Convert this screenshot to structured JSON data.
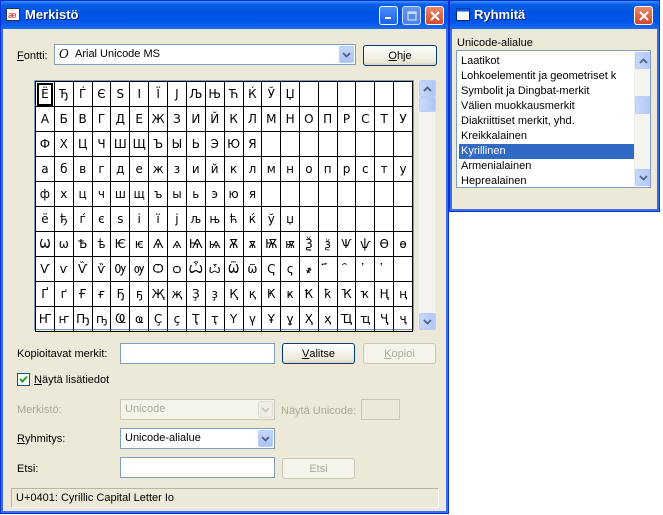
{
  "colors": {
    "titlebar": "#0054e3",
    "selection": "#316ac5",
    "face": "#ece9d8"
  },
  "main_window": {
    "title": "Merkistö",
    "icon": "charmap-icon",
    "font_label_prefix": "F",
    "font_label_rest": "ontti:",
    "font_value": "Arial Unicode MS",
    "font_type_glyph": "O",
    "help_prefix": "O",
    "help_rest": "hje",
    "grid_rows": [
      [
        "Ё",
        "Ђ",
        "Ѓ",
        "Є",
        "Ѕ",
        "І",
        "Ї",
        "Ј",
        "Љ",
        "Њ",
        "Ћ",
        "Ќ",
        "Ў",
        "Џ",
        "",
        "",
        "",
        "",
        "",
        ""
      ],
      [
        "А",
        "Б",
        "В",
        "Г",
        "Д",
        "Е",
        "Ж",
        "З",
        "И",
        "Й",
        "К",
        "Л",
        "М",
        "Н",
        "О",
        "П",
        "Р",
        "С",
        "Т",
        "У"
      ],
      [
        "Ф",
        "Х",
        "Ц",
        "Ч",
        "Ш",
        "Щ",
        "Ъ",
        "Ы",
        "Ь",
        "Э",
        "Ю",
        "Я",
        "",
        "",
        "",
        "",
        "",
        "",
        "",
        ""
      ],
      [
        "а",
        "б",
        "в",
        "г",
        "д",
        "е",
        "ж",
        "з",
        "и",
        "й",
        "к",
        "л",
        "м",
        "н",
        "о",
        "п",
        "р",
        "с",
        "т",
        "у"
      ],
      [
        "ф",
        "х",
        "ц",
        "ч",
        "ш",
        "щ",
        "ъ",
        "ы",
        "ь",
        "э",
        "ю",
        "я",
        "",
        "",
        "",
        "",
        "",
        "",
        "",
        ""
      ],
      [
        "ё",
        "ђ",
        "ѓ",
        "є",
        "ѕ",
        "і",
        "ї",
        "ј",
        "љ",
        "њ",
        "ћ",
        "ќ",
        "ў",
        "џ",
        "",
        "",
        "",
        "",
        "",
        ""
      ],
      [
        "Ѡ",
        "ѡ",
        "Ѣ",
        "ѣ",
        "Ѥ",
        "ѥ",
        "Ѧ",
        "ѧ",
        "Ѩ",
        "ѩ",
        "Ѫ",
        "ѫ",
        "Ѭ",
        "ѭ",
        "Ѯ",
        "ѯ",
        "Ѱ",
        "ѱ",
        "Ѳ",
        "ѳ"
      ],
      [
        "Ѵ",
        "ѵ",
        "Ѷ",
        "ѷ",
        "Ѹ",
        "ѹ",
        "Ѻ",
        "ѻ",
        "Ѽ",
        "ѽ",
        "Ѿ",
        "ѿ",
        "Ҁ",
        "ҁ",
        "҂",
        "҃",
        "҄",
        "҅",
        "҆",
        ""
      ],
      [
        "Ґ",
        "ґ",
        "Ғ",
        "ғ",
        "Ҕ",
        "ҕ",
        "Җ",
        "җ",
        "Ҙ",
        "ҙ",
        "Қ",
        "қ",
        "Ҝ",
        "ҝ",
        "Ҟ",
        "ҟ",
        "Ҡ",
        "ҡ",
        "Ң",
        "ң"
      ],
      [
        "Ҥ",
        "ҥ",
        "Ҧ",
        "ҧ",
        "Ҩ",
        "ҩ",
        "Ҫ",
        "ҫ",
        "Ҭ",
        "ҭ",
        "Ү",
        "ү",
        "Ұ",
        "ұ",
        "Ҳ",
        "ҳ",
        "Ҵ",
        "ҵ",
        "Ҷ",
        "ҷ"
      ]
    ],
    "copy_label": "Kopioitavat merkit:",
    "copy_value": "",
    "select_prefix": "V",
    "select_rest": "alitse",
    "copy_btn_prefix": "K",
    "copy_btn_rest": "opioi",
    "advanced_checked": true,
    "advanced_prefix": "N",
    "advanced_rest": "äytä lisätiedot",
    "charset_label": "Merkistö:",
    "charset_value": "Unicode",
    "goto_unicode_label": "Näytä Unicode:",
    "goto_unicode_value": "",
    "group_prefix": "R",
    "group_rest": "yhmitys:",
    "group_value": "Unicode-alialue",
    "search_label": "Etsi:",
    "search_value": "",
    "search_btn": "Etsi",
    "status": "U+0401: Cyrillic Capital Letter Io"
  },
  "group_window": {
    "title": "Ryhmitä",
    "header": "Unicode-alialue",
    "items": [
      "Laatikot",
      "Lohkoelementit ja geometriset k",
      "Symbolit ja Dingbat-merkit",
      "Välien muokkausmerkit",
      "Diakriittiset merkit, yhd.",
      "Kreikkalainen",
      "Kyrillinen",
      "Armenialainen",
      "Heprealainen"
    ],
    "selected_index": 6
  }
}
